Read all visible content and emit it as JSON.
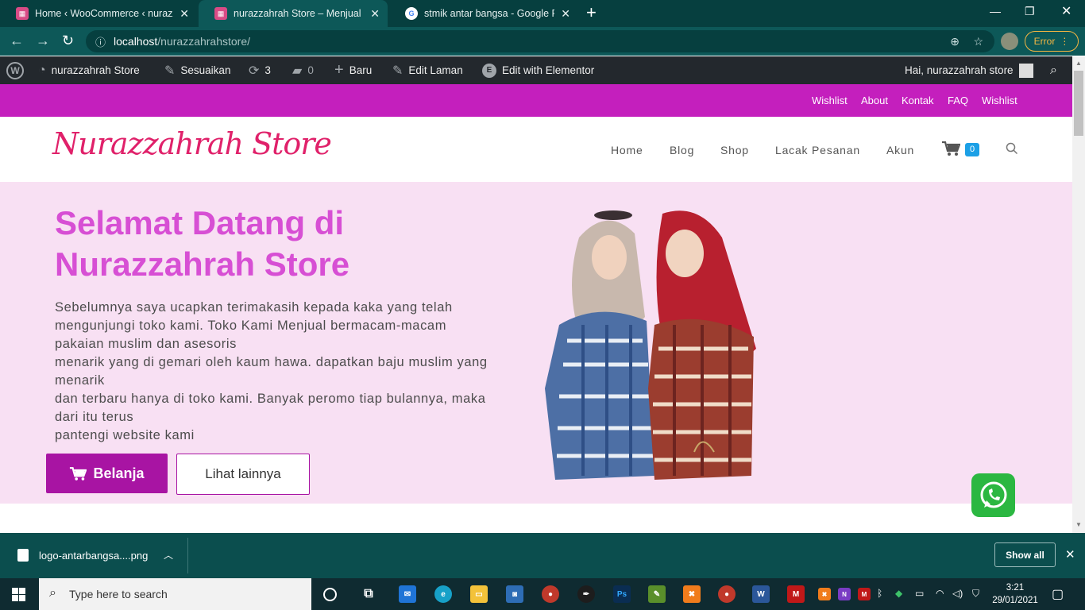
{
  "browser": {
    "tabs": [
      {
        "title": "Home ‹ WooCommerce ‹ nurazza",
        "active": false
      },
      {
        "title": "nurazzahrah Store – Menjual pro",
        "active": true
      },
      {
        "title": "stmik antar bangsa - Google Pen",
        "active": false
      }
    ],
    "new_tab": "+",
    "url_host": "localhost",
    "url_path": "/nurazzahrahstore/",
    "error_label": "Error"
  },
  "wp_admin_bar": {
    "site_name": "nurazzahrah Store",
    "customize": "Sesuaikan",
    "updates_count": "3",
    "comments_count": "0",
    "new": "Baru",
    "edit_page": "Edit Laman",
    "edit_elementor": "Edit with Elementor",
    "greeting": "Hai, nurazzahrah store"
  },
  "top_nav": [
    "Wishlist",
    "About",
    "Kontak",
    "FAQ",
    "Wishlist"
  ],
  "header": {
    "logo": "Nurazzahrah Store",
    "menu": [
      "Home",
      "Blog",
      "Shop",
      "Lacak Pesanan",
      "Akun"
    ],
    "cart_count": "0"
  },
  "hero": {
    "title_line1": "Selamat Datang di",
    "title_line2": "Nurazzahrah Store",
    "text_lines": [
      "Sebelumnya saya ucapkan terimakasih kepada kaka yang telah",
      "mengunjungi toko kami. Toko Kami Menjual bermacam-macam",
      "pakaian muslim dan asesoris",
      "menarik yang di gemari oleh kaum hawa. dapatkan baju muslim yang",
      "menarik",
      "dan terbaru hanya di toko kami. Banyak peromo tiap bulannya, maka",
      "dari itu terus",
      "pantengi website kami"
    ],
    "btn_primary": "Belanja",
    "btn_secondary": "Lihat lainnya"
  },
  "download_shelf": {
    "file": "logo-antarbangsa....png",
    "show_all": "Show all"
  },
  "taskbar": {
    "search_placeholder": "Type here to search",
    "time": "3:21",
    "date": "29/01/2021"
  },
  "colors": {
    "accent_magenta": "#c41fbd",
    "hero_bg": "#f8e0f3",
    "title": "#d74fd4",
    "button": "#a814a3",
    "logo": "#e0216a"
  }
}
